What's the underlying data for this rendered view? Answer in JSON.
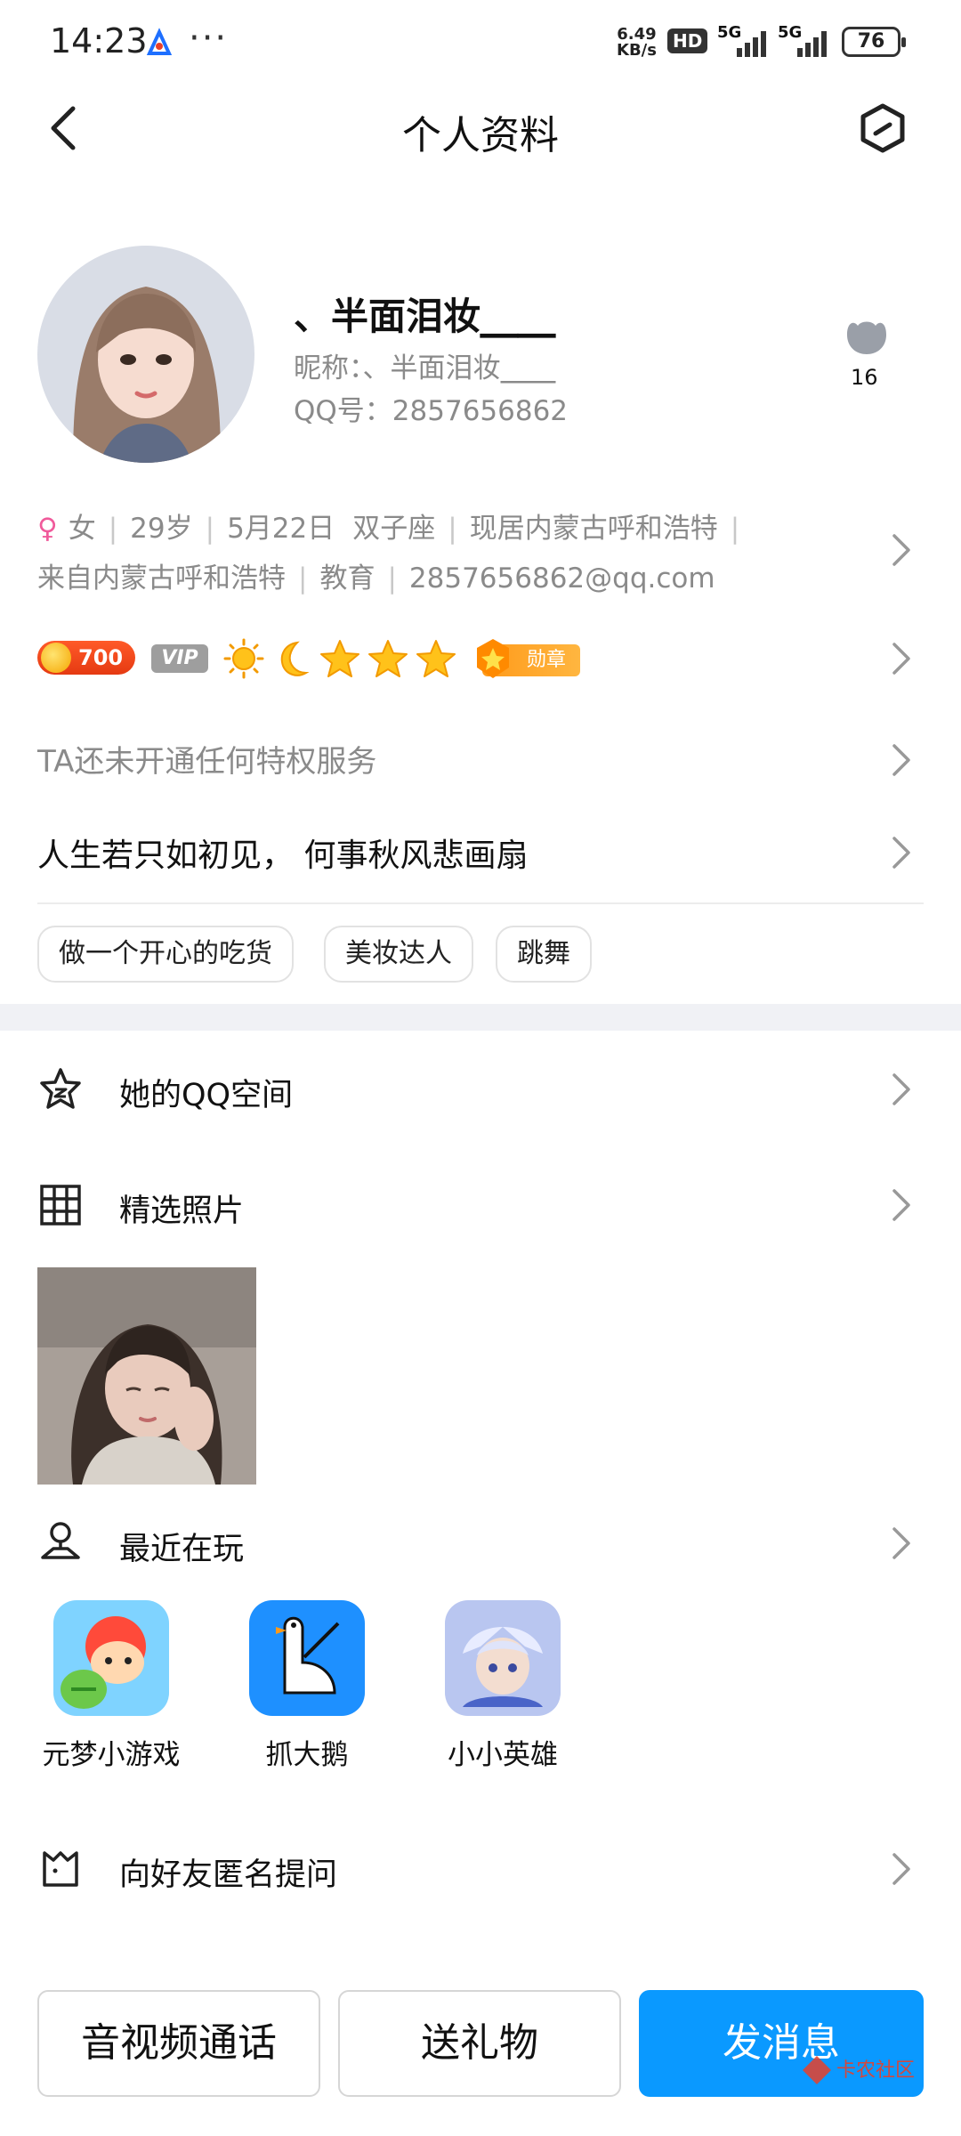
{
  "status_bar": {
    "time": "14:23",
    "dots": "···",
    "speed_value": "6.49",
    "speed_unit": "KB/s",
    "hd_label": "HD",
    "net1": "5G",
    "net2": "5G",
    "battery": "76"
  },
  "header": {
    "title": "个人资料"
  },
  "profile": {
    "name": "、半面泪妆⎽⎽",
    "nickname": "昵称：、半面泪妆⎽⎽",
    "qq_number": "QQ号：2857656862",
    "like_count": "16"
  },
  "info": {
    "gender": "女",
    "age": "29岁",
    "birthday": "5月22日",
    "zodiac": "双子座",
    "residence": "现居内蒙古呼和浩特",
    "hometown": "来自内蒙古呼和浩特",
    "occupation": "教育",
    "email": "2857656862@qq.com"
  },
  "badges": {
    "coins": "700",
    "vip": "VIP",
    "medal": "勋章"
  },
  "privilege_text": "TA还未开通任何特权服务",
  "signature": "人生若只如初见， 何事秋风悲画扇",
  "tags": [
    "做一个开心的吃货",
    "美妆达人",
    "跳舞"
  ],
  "rows": {
    "qzone": "她的QQ空间",
    "photos": "精选照片",
    "recent_games": "最近在玩",
    "anon_question": "向好友匿名提问"
  },
  "games": [
    {
      "name": "元梦小游戏"
    },
    {
      "name": "抓大鹅"
    },
    {
      "name": "小小英雄"
    }
  ],
  "buttons": {
    "call": "音视频通话",
    "gift": "送礼物",
    "message": "发消息"
  },
  "watermark": "卡农社区",
  "colors": {
    "primary": "#0a99ff",
    "coin": "#e53a12",
    "medal": "#ff9a1a",
    "gender": "#f05a9b"
  }
}
